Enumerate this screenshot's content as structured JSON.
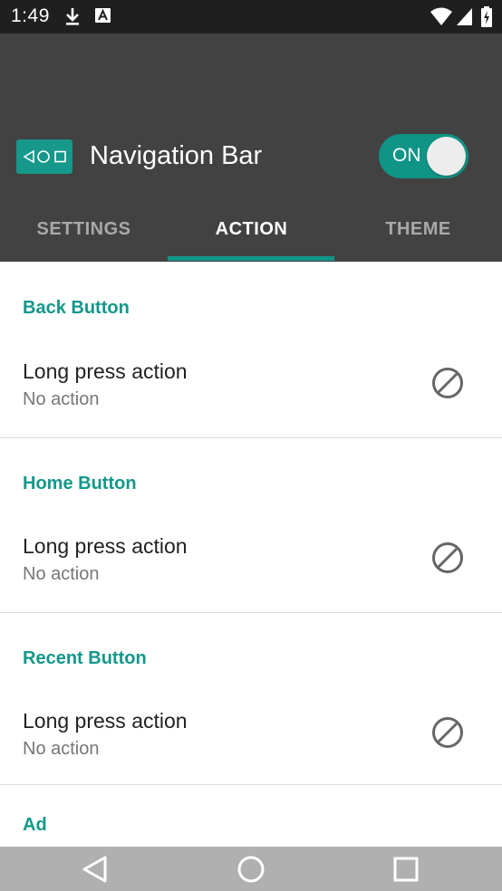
{
  "status_bar": {
    "time": "1:49",
    "icons": [
      "download-icon",
      "a-icon",
      "wifi-icon",
      "signal-icon",
      "battery-icon"
    ]
  },
  "app_bar": {
    "title": "Navigation Bar",
    "logo_icon": "nav-buttons-icon",
    "toggle": {
      "label": "ON",
      "state": true,
      "color": "#0f9486"
    },
    "tabs": [
      {
        "label": "SETTINGS",
        "active": false
      },
      {
        "label": "ACTION",
        "active": true
      },
      {
        "label": "THEME",
        "active": false
      }
    ]
  },
  "sections": [
    {
      "header": "Back Button",
      "pref_title": "Long press action",
      "pref_summary": "No action",
      "icon": "no-action-icon"
    },
    {
      "header": "Home Button",
      "pref_title": "Long press action",
      "pref_summary": "No action",
      "icon": "no-action-icon"
    },
    {
      "header": "Recent Button",
      "pref_title": "Long press action",
      "pref_summary": "No action",
      "icon": "no-action-icon"
    },
    {
      "header": "Ad"
    }
  ],
  "nav_bar": {
    "buttons": [
      "back-icon",
      "home-icon",
      "recents-icon"
    ]
  },
  "colors": {
    "accent": "#13988a",
    "app_bar": "#424242",
    "status_bar": "#1f1f1f",
    "nav_bar": "#b0b0b0"
  }
}
